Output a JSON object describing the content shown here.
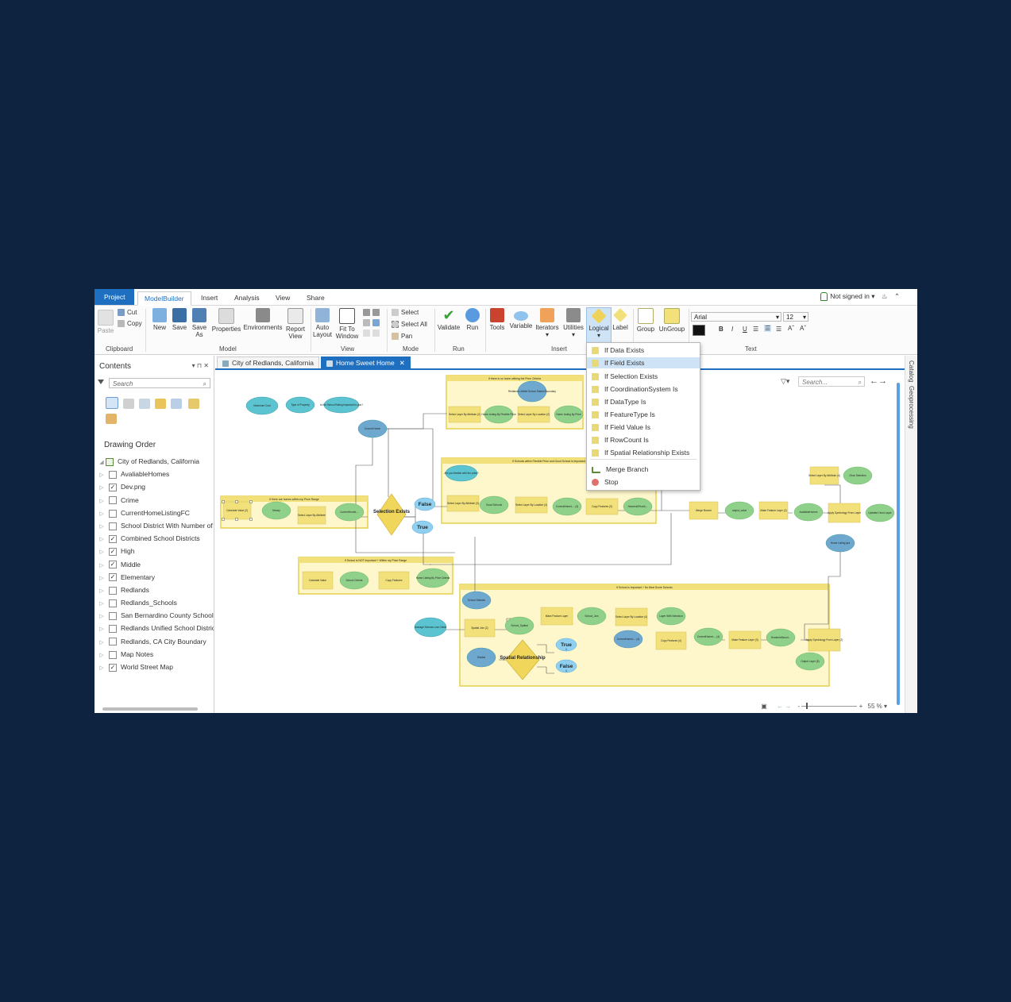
{
  "tabs": {
    "project": "Project",
    "modelbuilder": "ModelBuilder",
    "insert": "Insert",
    "analysis": "Analysis",
    "view": "View",
    "share": "Share"
  },
  "account": {
    "status": "Not signed in",
    "arrow": "▾"
  },
  "ribbon": {
    "clipboard": {
      "paste": "Paste",
      "cut": "Cut",
      "copy": "Copy",
      "group": "Clipboard"
    },
    "model": {
      "new": "New",
      "save": "Save",
      "save_as": "Save As",
      "properties": "Properties",
      "environments": "Environments",
      "report": "Report View",
      "group": "Model"
    },
    "view": {
      "auto_layout": "Auto Layout",
      "fit": "Fit To Window",
      "group": "View"
    },
    "mode": {
      "select": "Select",
      "select_all": "Select All",
      "pan": "Pan",
      "group": "Mode"
    },
    "run": {
      "validate": "Validate",
      "run": "Run",
      "group": "Run"
    },
    "insert": {
      "tools": "Tools",
      "variable": "Variable",
      "iterators": "Iterators",
      "utilities": "Utilities",
      "logical": "Logical",
      "label": "Label",
      "group": "Insert"
    },
    "group_ctrl": {
      "group": "Group",
      "ungroup": "UnGroup"
    },
    "text": {
      "font": "Arial",
      "size": "12",
      "bold": "B",
      "italic": "I",
      "underline": "U",
      "group": "Text"
    }
  },
  "contents": {
    "title": "Contents",
    "controls": "▾ ⊓ ✕",
    "search_placeholder": "Search",
    "drawing_order": "Drawing Order",
    "map_name": "City of Redlands, California",
    "layers": [
      {
        "name": "AvaliableHomes",
        "checked": ""
      },
      {
        "name": "Dev.png",
        "checked": "✓"
      },
      {
        "name": "Crime",
        "checked": ""
      },
      {
        "name": "CurrentHomeListingFC",
        "checked": ""
      },
      {
        "name": "School District With Number of Grade",
        "checked": ""
      },
      {
        "name": "Combined School Districts",
        "checked": "✓"
      },
      {
        "name": "High",
        "checked": "✓"
      },
      {
        "name": "Middle",
        "checked": "✓"
      },
      {
        "name": "Elementary",
        "checked": "✓"
      },
      {
        "name": "Redlands",
        "checked": ""
      },
      {
        "name": "Redlands_Schools",
        "checked": ""
      },
      {
        "name": "San Bernardino County School Districts",
        "checked": ""
      },
      {
        "name": "Redlands Unified School District",
        "checked": ""
      },
      {
        "name": "Redlands, CA City Boundary",
        "checked": ""
      },
      {
        "name": "Map Notes",
        "checked": ""
      },
      {
        "name": "World Street Map",
        "checked": "✓"
      }
    ]
  },
  "doc_tabs": [
    {
      "label": "City of Redlands, California"
    },
    {
      "label": "Home Sweet Home",
      "close": "✕"
    }
  ],
  "canvas": {
    "search_placeholder": "Search...",
    "zoom": "55 %",
    "vars": [
      "Maximum Cost",
      "Type of Property",
      "Is the School Rating important to you?",
      "Current Home",
      "Redlands Unified School District Boundary",
      "Are you flexible with the price?",
      "Average Schools Low Crime",
      "School Districts",
      "Grades",
      "Home Listing lyrs"
    ],
    "groups": [
      "If there are homes within my Price Range",
      "If there is no home withing the Price Criteria",
      "If Schools within Flexible Price and Good School is Important",
      "If School is NOT Important + Within my Price Range",
      "If School is Important + No Best Score Schools"
    ],
    "tools": [
      "Calculate Value (2)",
      "Select Layer By Attribute",
      "Select Layer By Attribute (2)",
      "Select Layer By Location (2)",
      "Select Layer By Attribute (3)",
      "Select Layer By Location (3)",
      "Copy Features (3)",
      "Merge Branch",
      "Make Feature Layer (2)",
      "Apply Symbology From Layer",
      "Select Layer By Attribute (4)",
      "Calculate Value",
      "Copy Features",
      "Spatial Join (2)",
      "Make Feature Layer",
      "Select Layer By Location (4)",
      "Copy Features (4)",
      "Make Feature Layer (3)",
      "Apply Symbology From Layer (2)"
    ],
    "outputs": [
      "Money",
      "CurrentHomeL...",
      "Home Listing By Flexible Price",
      "Home Listing By Price",
      "Good Schools",
      "CurrentHomeL... (3)",
      "HomesInPriceA...",
      "output_value",
      "AvaliableHomes",
      "Updated Hood Layer",
      "Clear Selection",
      "School Criteria",
      "Home Listing By Price Criteria",
      "School_Spatial",
      "School_Join",
      "Layer With Selection",
      "CurrentHomeL... (4)",
      "HomesInSecuri...",
      "Output Layer (5)",
      "HomeOutOfYo..."
    ],
    "conditions": [
      "Selection Exists",
      "Spatial Relationship"
    ],
    "bool": [
      "False",
      "True",
      "True",
      "False"
    ],
    "bool_sub": [
      "1",
      "1"
    ]
  },
  "logical_menu": [
    {
      "label": "If Data Exists",
      "icon": "if-data-exists-icon"
    },
    {
      "label": "If Field Exists",
      "icon": "if-field-exists-icon"
    },
    {
      "label": "If Selection Exists",
      "icon": "if-selection-exists-icon"
    },
    {
      "label": "If CoordinationSystem Is",
      "icon": "if-coordinate-system-icon"
    },
    {
      "label": "If DataType Is",
      "icon": "if-datatype-icon"
    },
    {
      "label": "If FeatureType Is",
      "icon": "if-featuretype-icon"
    },
    {
      "label": "If Field Value Is",
      "icon": "if-field-value-icon"
    },
    {
      "label": "If RowCount Is",
      "icon": "if-rowcount-icon"
    },
    {
      "label": "If Spatial Relationship Exists",
      "icon": "if-spatial-relationship-icon"
    },
    {
      "label": "Merge Branch",
      "icon": "merge-branch-icon"
    },
    {
      "label": "Stop",
      "icon": "stop-icon"
    }
  ],
  "side_panels": {
    "catalog": "Catalog",
    "geoprocessing": "Geoprocessing"
  },
  "colors": {
    "accent": "#1f6fc1",
    "tool": "#f2e07a",
    "output": "#8fd18a",
    "variable": "#5bc4d0",
    "group_bg": "#fff7cc",
    "group_border": "#e6cf4d"
  }
}
